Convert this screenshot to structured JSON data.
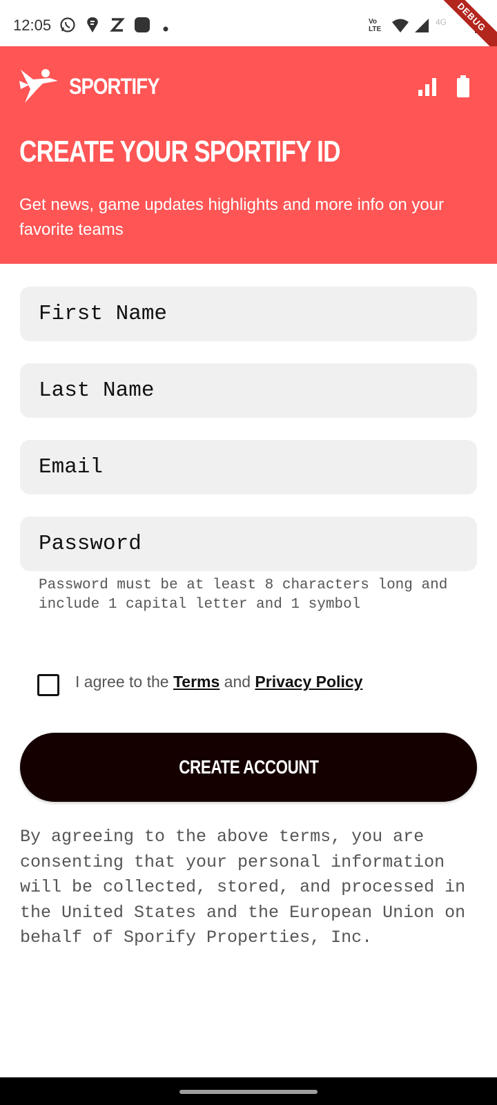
{
  "status_bar": {
    "time": "12:05",
    "icons": [
      "whatsapp-icon",
      "swiggy-icon",
      "zomato-icon",
      "app-icon",
      "dot-icon",
      "volte-icon",
      "wifi-icon",
      "cell-signal-icon",
      "4g-icon",
      "battery-icon"
    ],
    "volte_label": "Vo LTE",
    "network_label": "4G",
    "debug_label": "DEBUG"
  },
  "header": {
    "brand": "SPORTIFY",
    "title": "CREATE YOUR SPORTIFY ID",
    "subtitle": "Get news, game updates highlights and more info on your favorite teams",
    "icons": [
      "signal-bars-icon",
      "battery-icon"
    ]
  },
  "form": {
    "first_name_placeholder": "First Name",
    "last_name_placeholder": "Last Name",
    "email_placeholder": "Email",
    "password_placeholder": "Password",
    "password_hint": "Password must be at least 8 characters long and include 1 capital letter and 1 symbol",
    "agree_prefix": "I agree to the ",
    "terms_link": "Terms",
    "agree_and": " and ",
    "privacy_link": "Privacy Policy",
    "checkbox_checked": false,
    "create_button": "CREATE ACCOUNT",
    "disclaimer": "By agreeing to the above terms, you are consenting that your personal information will be collected, stored, and processed in the United States and the European Union on behalf of Sporify Properties, Inc."
  },
  "colors": {
    "header_bg": "#ff5555",
    "button_bg": "#150000",
    "field_bg": "#f0f0f0"
  }
}
